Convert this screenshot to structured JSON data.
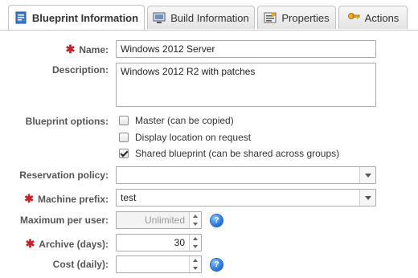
{
  "tabs": [
    {
      "label": "Blueprint Information",
      "icon": "blueprint-doc-icon",
      "active": true
    },
    {
      "label": "Build Information",
      "icon": "build-monitor-icon",
      "active": false
    },
    {
      "label": "Properties",
      "icon": "properties-icon",
      "active": false
    },
    {
      "label": "Actions",
      "icon": "key-icon",
      "active": false
    }
  ],
  "form": {
    "name": {
      "label": "Name:",
      "required": true,
      "value": "Windows 2012 Server"
    },
    "description": {
      "label": "Description:",
      "value": "Windows 2012 R2 with patches"
    },
    "options": {
      "label": "Blueprint options:",
      "items": [
        {
          "label": "Master (can be copied)",
          "checked": false
        },
        {
          "label": "Display location on request",
          "checked": false
        },
        {
          "label": "Shared blueprint (can be shared across groups)",
          "checked": true
        }
      ]
    },
    "reservation_policy": {
      "label": "Reservation policy:",
      "value": ""
    },
    "machine_prefix": {
      "label": "Machine prefix:",
      "required": true,
      "value": "test"
    },
    "max_per_user": {
      "label": "Maximum per user:",
      "value": "Unlimited"
    },
    "archive_days": {
      "label": "Archive (days):",
      "required": true,
      "value": "30"
    },
    "cost_daily": {
      "label": "Cost (daily):",
      "value": ""
    }
  },
  "colors": {
    "required_star": "#c0242a",
    "help_icon": "#1d6fd8"
  }
}
